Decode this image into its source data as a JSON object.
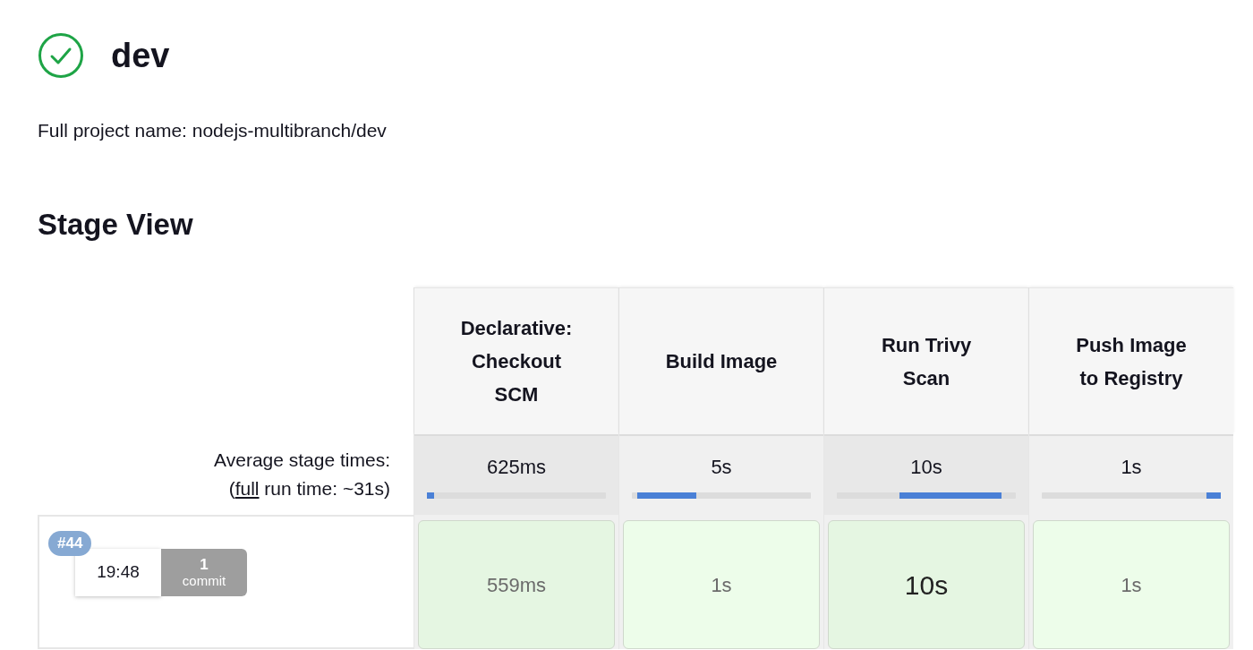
{
  "job": {
    "succeeded": true,
    "title": "dev",
    "full_name_label": "Full project name: nodejs-multibranch/dev"
  },
  "stage_view": {
    "heading": "Stage View",
    "average_label": "Average stage times:",
    "full_run_prefix": "(",
    "full_run_link": "full",
    "full_run_suffix": " run time: ~31s)",
    "stages": [
      {
        "name": "Declarative: Checkout SCM",
        "average": "625ms"
      },
      {
        "name": "Build Image",
        "average": "5s"
      },
      {
        "name": "Run Trivy Scan",
        "average": "10s"
      },
      {
        "name": "Push Image to Registry",
        "average": "1s"
      }
    ],
    "runs": [
      {
        "number": "#44",
        "time": "19:48",
        "commits": "1",
        "commits_label": "commit",
        "cells": [
          {
            "duration": "559ms",
            "emphasized": false
          },
          {
            "duration": "1s",
            "emphasized": false
          },
          {
            "duration": "10s",
            "emphasized": true
          },
          {
            "duration": "1s",
            "emphasized": false
          }
        ]
      }
    ]
  }
}
